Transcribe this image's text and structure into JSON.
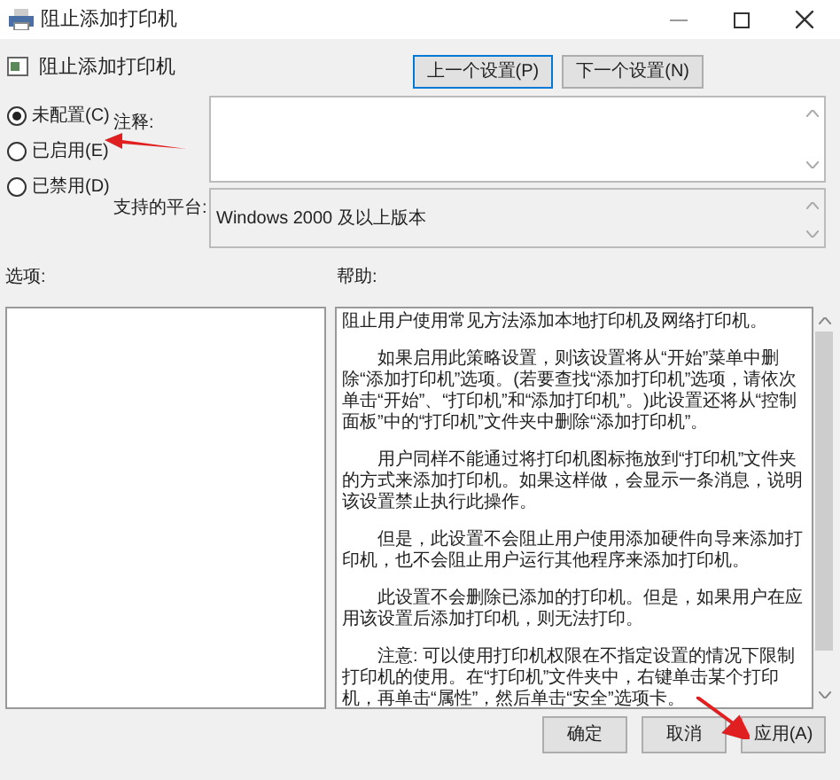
{
  "window": {
    "title": "阻止添加打印机"
  },
  "header": {
    "title": "阻止添加打印机"
  },
  "nav_buttons": [
    {
      "label": "上一个设置(P)",
      "selected": true
    },
    {
      "label": "下一个设置(N)",
      "selected": false
    }
  ],
  "radios": [
    {
      "label": "未配置(C)",
      "selected": true
    },
    {
      "label": "已启用(E)",
      "selected": false
    },
    {
      "label": "已禁用(D)",
      "selected": false
    }
  ],
  "comment": {
    "label": "注释:"
  },
  "platform": {
    "label": "支持的平台:",
    "value": "Windows 2000 及以上版本"
  },
  "options": {
    "label": "选项:"
  },
  "help": {
    "label": "帮助:",
    "paragraphs": [
      "阻止用户使用常见方法添加本地打印机及网络打印机。",
      "如果启用此策略设置，则该设置将从“开始”菜单中删除“添加打印机”选项。(若要查找“添加打印机”选项，请依次单击“开始”、“打印机”和“添加打印机”。)此设置还将从“控制面板”中的“打印机”文件夹中删除“添加打印机”。",
      "用户同样不能通过将打印机图标拖放到“打印机”文件夹的方式来添加打印机。如果这样做，会显示一条消息，说明该设置禁止执行此操作。",
      "但是，此设置不会阻止用户使用添加硬件向导来添加打印机，也不会阻止用户运行其他程序来添加打印机。",
      "此设置不会删除已添加的打印机。但是，如果用户在应用该设置后添加打印机，则无法打印。",
      "注意: 可以使用打印机权限在不指定设置的情况下限制打印机的使用。在“打印机”文件夹中，右键单击某个打印机，再单击“属性”，然后单击“安全”选项卡。"
    ]
  },
  "footer_buttons": [
    {
      "label": "确定"
    },
    {
      "label": "取消"
    },
    {
      "label": "应用(A)"
    }
  ]
}
